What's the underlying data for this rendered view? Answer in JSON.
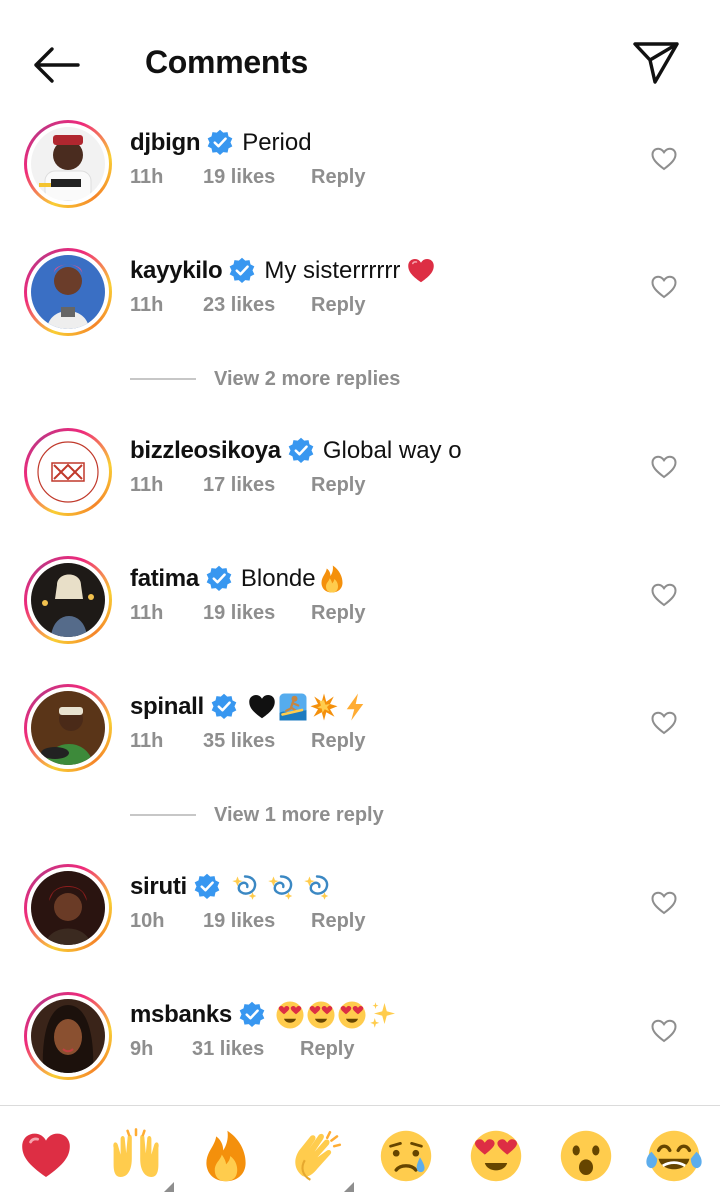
{
  "header": {
    "title": "Comments",
    "back_icon": "arrow-left-icon",
    "send_icon": "paper-plane-icon"
  },
  "comments": [
    {
      "username": "djbign",
      "text": "Period",
      "emojis": [],
      "time": "11h",
      "likes": "19 likes",
      "reply": "Reply"
    },
    {
      "username": "kayykilo",
      "text": "My sisterrrrrr",
      "emojis": [
        "red-heart"
      ],
      "time": "11h",
      "likes": "23 likes",
      "reply": "Reply"
    },
    {
      "username": "bizzleosikoya",
      "text": "Global way o",
      "emojis": [],
      "time": "11h",
      "likes": "17 likes",
      "reply": "Reply"
    },
    {
      "username": "fatima",
      "text": "Blonde",
      "emojis": [
        "fire"
      ],
      "time": "11h",
      "likes": "19 likes",
      "reply": "Reply"
    },
    {
      "username": "spinall",
      "text": "",
      "emojis": [
        "black-heart",
        "surfer",
        "collision",
        "lightning"
      ],
      "time": "11h",
      "likes": "35 likes",
      "reply": "Reply"
    },
    {
      "username": "siruti",
      "text": "",
      "emojis": [
        "dizzy",
        "dizzy",
        "dizzy"
      ],
      "time": "10h",
      "likes": "19 likes",
      "reply": "Reply"
    },
    {
      "username": "msbanks",
      "text": "",
      "emojis": [
        "heart-eyes",
        "heart-eyes",
        "heart-eyes",
        "sparkles"
      ],
      "time": "9h",
      "likes": "31 likes",
      "reply": "Reply"
    }
  ],
  "view_more": [
    {
      "text": "View 2 more replies"
    },
    {
      "text": "View 1 more reply"
    }
  ],
  "quick_emojis": [
    "red-heart",
    "raising-hands",
    "fire",
    "clapping-hands",
    "crying-face",
    "heart-eyes",
    "astonished-face",
    "tears-of-joy"
  ],
  "colors": {
    "verified_blue": "#3897f0",
    "secondary_text": "#8e8e8e",
    "ring_gradient": [
      "#f9ce34",
      "#ee2a7b",
      "#c13584"
    ]
  }
}
